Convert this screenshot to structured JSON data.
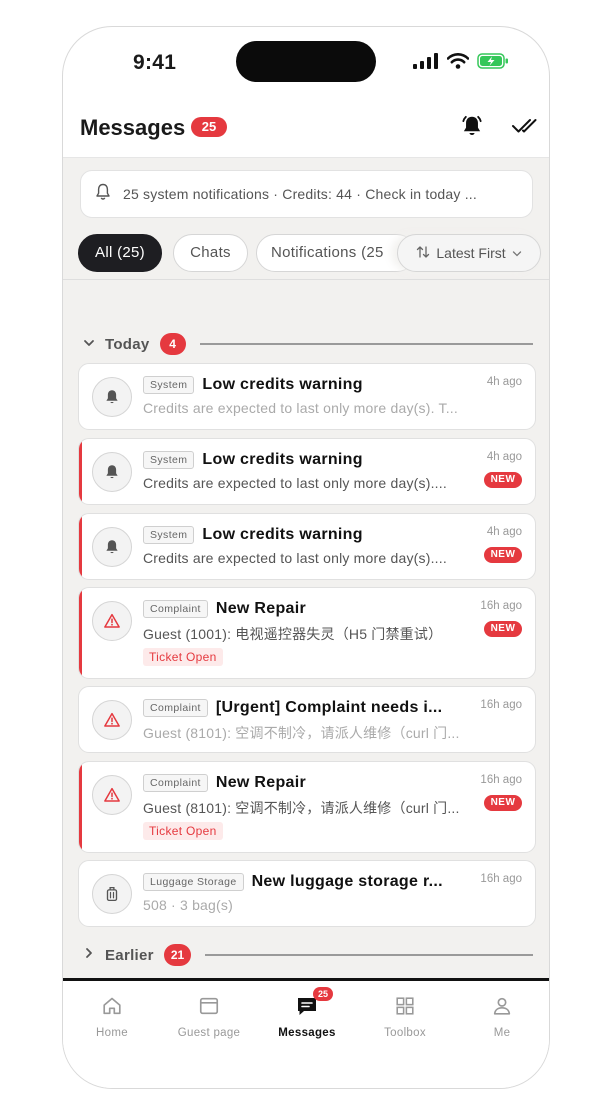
{
  "status_bar": {
    "time": "9:41"
  },
  "header": {
    "title": "Messages",
    "unread_count": "25"
  },
  "system_banner": {
    "text": "25 system notifications · Credits: 44 · Check in today ..."
  },
  "filters": {
    "tabs": [
      {
        "label": "All (25)",
        "active": true
      },
      {
        "label": "Chats",
        "active": false
      },
      {
        "label": "Notifications (25",
        "active": false
      }
    ],
    "sort_label": "Latest First"
  },
  "sections": {
    "today": {
      "label": "Today",
      "count": "4",
      "expanded": true
    },
    "earlier": {
      "label": "Earlier",
      "count": "21",
      "expanded": false
    }
  },
  "messages": [
    {
      "icon": "bell-icon",
      "tag": "System",
      "title": "Low credits warning",
      "body": "Credits are expected to last only  more day(s). T...",
      "time": "4h ago",
      "unread": false,
      "muted": true,
      "new_label": "",
      "status": ""
    },
    {
      "icon": "bell-icon",
      "tag": "System",
      "title": "Low credits warning",
      "body": "Credits are expected to last only  more day(s)....",
      "time": "4h ago",
      "unread": true,
      "muted": false,
      "new_label": "NEW",
      "status": ""
    },
    {
      "icon": "bell-icon",
      "tag": "System",
      "title": "Low credits warning",
      "body": "Credits are expected to last only  more day(s)....",
      "time": "4h ago",
      "unread": true,
      "muted": false,
      "new_label": "NEW",
      "status": ""
    },
    {
      "icon": "warning-icon",
      "tag": "Complaint",
      "title": "New Repair",
      "body": "Guest (1001): 电视遥控器失灵（H5 门禁重试）",
      "time": "16h ago",
      "unread": true,
      "muted": false,
      "new_label": "NEW",
      "status": "Ticket Open"
    },
    {
      "icon": "warning-icon",
      "tag": "Complaint",
      "title": "[Urgent] Complaint needs i...",
      "body": "Guest (8101): 空调不制冷，请派人维修（curl 门...",
      "time": "16h ago",
      "unread": false,
      "muted": true,
      "new_label": "",
      "status": ""
    },
    {
      "icon": "warning-icon",
      "tag": "Complaint",
      "title": "New Repair",
      "body": "Guest (8101): 空调不制冷，请派人维修（curl 门...",
      "time": "16h ago",
      "unread": true,
      "muted": false,
      "new_label": "NEW",
      "status": "Ticket Open"
    },
    {
      "icon": "luggage-icon",
      "tag": "Luggage Storage",
      "title": "New luggage storage r...",
      "body": "508 · 3 bag(s)",
      "time": "16h ago",
      "unread": false,
      "muted": true,
      "new_label": "",
      "status": ""
    }
  ],
  "bottom_nav": [
    {
      "label": "Home",
      "icon": "home-icon",
      "active": false,
      "badge": ""
    },
    {
      "label": "Guest page",
      "icon": "browser-window-icon",
      "active": false,
      "badge": ""
    },
    {
      "label": "Messages",
      "icon": "chat-icon",
      "active": true,
      "badge": "25"
    },
    {
      "label": "Toolbox",
      "icon": "grid-icon",
      "active": false,
      "badge": ""
    },
    {
      "label": "Me",
      "icon": "user-icon",
      "active": false,
      "badge": ""
    }
  ],
  "colors": {
    "accent_red": "#e5393f",
    "active_chip": "#1e1e22",
    "background": "#f2f1ef",
    "battery_green": "#34c759"
  }
}
